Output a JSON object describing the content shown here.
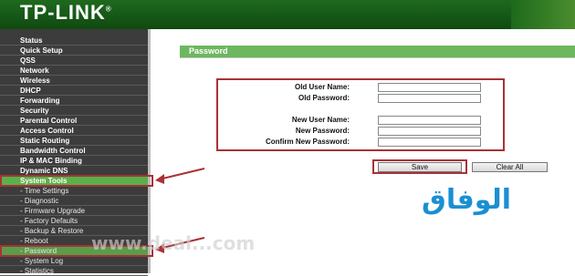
{
  "header": {
    "logo_text": "TP-LINK",
    "trademark": "®"
  },
  "sidebar": {
    "items": [
      {
        "label": "Status",
        "type": "main"
      },
      {
        "label": "Quick Setup",
        "type": "main"
      },
      {
        "label": "QSS",
        "type": "main"
      },
      {
        "label": "Network",
        "type": "main"
      },
      {
        "label": "Wireless",
        "type": "main"
      },
      {
        "label": "DHCP",
        "type": "main"
      },
      {
        "label": "Forwarding",
        "type": "main"
      },
      {
        "label": "Security",
        "type": "main"
      },
      {
        "label": "Parental Control",
        "type": "main"
      },
      {
        "label": "Access Control",
        "type": "main"
      },
      {
        "label": "Static Routing",
        "type": "main"
      },
      {
        "label": "Bandwidth Control",
        "type": "main"
      },
      {
        "label": "IP & MAC Binding",
        "type": "main"
      },
      {
        "label": "Dynamic DNS",
        "type": "main"
      },
      {
        "label": "System Tools",
        "type": "main",
        "state": "active"
      },
      {
        "label": "- Time Settings",
        "type": "sub"
      },
      {
        "label": "- Diagnostic",
        "type": "sub"
      },
      {
        "label": "- Firmware Upgrade",
        "type": "sub"
      },
      {
        "label": "- Factory Defaults",
        "type": "sub"
      },
      {
        "label": "- Backup & Restore",
        "type": "sub"
      },
      {
        "label": "- Reboot",
        "type": "sub"
      },
      {
        "label": "- Password",
        "type": "sub",
        "state": "active"
      },
      {
        "label": "- System Log",
        "type": "sub"
      },
      {
        "label": "- Statistics",
        "type": "sub"
      }
    ]
  },
  "main": {
    "title": "Password",
    "fields": {
      "old_user_name": {
        "label": "Old User Name:",
        "value": ""
      },
      "old_password": {
        "label": "Old Password:",
        "value": ""
      },
      "new_user_name": {
        "label": "New User Name:",
        "value": ""
      },
      "new_password": {
        "label": "New Password:",
        "value": ""
      },
      "confirm_new_password": {
        "label": "Confirm New Password:",
        "value": ""
      }
    },
    "buttons": {
      "save": "Save",
      "clear_all": "Clear All"
    }
  },
  "watermark": {
    "logo": "الوفاق",
    "url": "www.deal...com"
  },
  "colors": {
    "header_green": "#1f6a1f",
    "sidebar_bg": "#3c3c3c",
    "active_green": "#5ab04a",
    "title_bar_green": "#6db75e",
    "highlight_red": "#a83236",
    "watermark_blue": "#1b8fd2"
  }
}
